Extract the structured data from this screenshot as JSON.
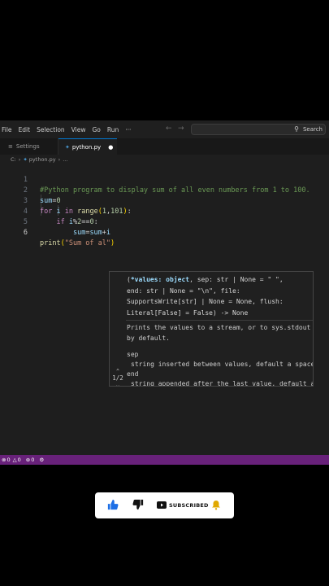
{
  "menubar": {
    "items": [
      "File",
      "Edit",
      "Selection",
      "View",
      "Go",
      "Run",
      "···"
    ],
    "search_placeholder": "Search"
  },
  "tabs": [
    {
      "label": "Settings",
      "active": false
    },
    {
      "label": "python.py",
      "active": true,
      "modified": true
    }
  ],
  "breadcrumb": {
    "root": "C:",
    "file": "python.py",
    "more": "..."
  },
  "editor": {
    "language": "python",
    "lines": [
      {
        "number": "1",
        "text": "#Python program to display sum of all even numbers from 1 to 100."
      },
      {
        "number": "2",
        "text": "sum=0"
      },
      {
        "number": "3",
        "text": "for i in range(1,101):"
      },
      {
        "number": "4",
        "text": "    if i%2==0:"
      },
      {
        "number": "5",
        "text": "        sum=sum+i"
      },
      {
        "number": "6",
        "text": "print(\"Sum of al\")"
      }
    ]
  },
  "hover": {
    "signature_lines": [
      "(*values: object, sep: str | None = \" \",",
      "end: str | None = \"\\n\", file:",
      "SupportsWrite[str] | None = None, flush:",
      "Literal[False] = False) -> None"
    ],
    "description": "Prints the values to a stream, or to sys.stdout by default.",
    "params": [
      {
        "name": "sep",
        "text": "string inserted between values, default a space."
      },
      {
        "name": "end",
        "text": "string appended after the last value, default a"
      }
    ],
    "pager": "1/2"
  },
  "statusbar": {
    "errors": "0",
    "warnings": "0",
    "ports": "0"
  },
  "overlay": {
    "subscribe_label": "SUBSCRIBED"
  },
  "colors": {
    "statusbar": "#68217a",
    "accent": "#0078d4",
    "editor_bg": "#1e1e1e"
  }
}
